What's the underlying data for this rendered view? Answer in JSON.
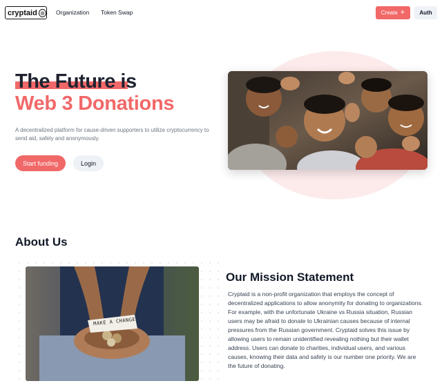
{
  "nav": {
    "logo_text": "cryptaid",
    "links": [
      "Organization",
      "Token Swap"
    ],
    "create_label": "Create",
    "auth_label": "Auth"
  },
  "hero": {
    "title_line1": "The Future is",
    "title_line2": "Web 3 Donations",
    "description": "A decentralized platform for cause-driven supporters to utilize cryptocurrency to send aid, safely and anonymously.",
    "start_button": "Start funding",
    "login_button": "Login"
  },
  "about": {
    "heading": "About Us",
    "photo_caption": "MAKE A CHANGE",
    "mission_title": "Our Mission Statement",
    "mission_body": "Cryptaid is a non-profit organization that employs the concept of decentralized applications to allow anonymity for donating to organizations. For example, with the unfortunate Ukraine vs Russia situation, Russian users may be afraid to donate to Ukrainian causes because of internal pressures from the Russian government. Cryptaid solves this issue by allowing users to remain unidentified revealing nothing but their wallet address. Users can donate to charities, individual users, and various causes, knowing their data and safety is our number one priority. We are the future of donating."
  },
  "colors": {
    "accent": "#f16868",
    "muted_button": "#eef1f5",
    "blob": "#fde9ea"
  }
}
